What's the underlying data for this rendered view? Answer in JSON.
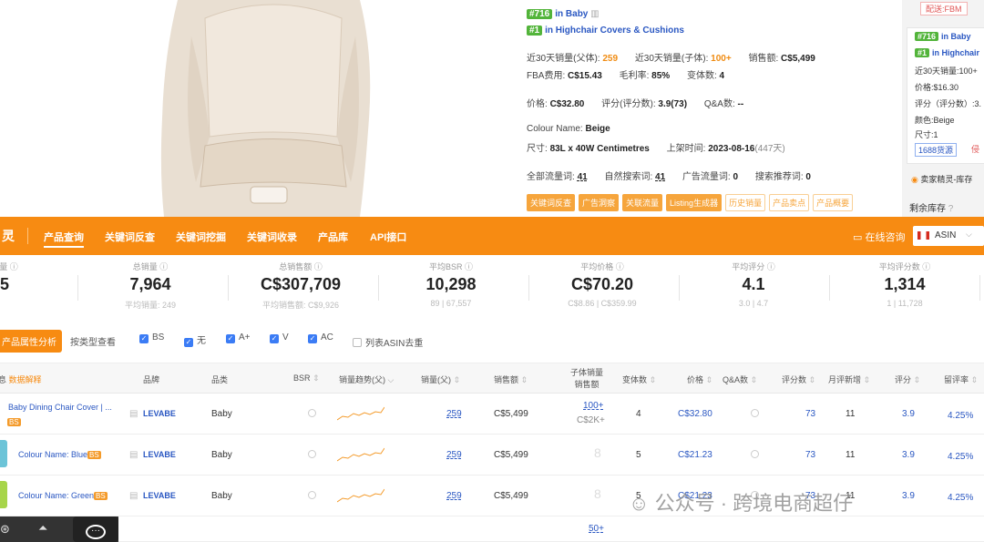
{
  "detail": {
    "rank1": {
      "badge": "#716",
      "text": "in Baby"
    },
    "rank2": {
      "badge": "#1",
      "text": "in Highchair Covers & Cushions"
    },
    "line1": {
      "a_label": "近30天销量(父体):",
      "a_val": "259",
      "b_label": "近30天销量(子体):",
      "b_val": "100+",
      "c_label": "销售额:",
      "c_val": "C$5,499"
    },
    "line2": {
      "a_label": "FBA费用:",
      "a_val": "C$15.43",
      "b_label": "毛利率:",
      "b_val": "85%",
      "c_label": "变体数:",
      "c_val": "4"
    },
    "line3": {
      "a_label": "价格:",
      "a_val": "C$32.80",
      "b_label": "评分(评分数):",
      "b_val": "3.9(73)",
      "c_label": "Q&A数:",
      "c_val": "--"
    },
    "colour": {
      "label": "Colour Name:",
      "val": "Beige"
    },
    "size": {
      "label": "尺寸:",
      "val": "83L x 40W Centimetres",
      "date_label": "上架时间:",
      "date_val": "2023-08-16",
      "days": "(447天)"
    },
    "keywords": {
      "a_label": "全部流量词:",
      "a_val": "41",
      "b_label": "自然搜索词:",
      "b_val": "41",
      "c_label": "广告流量词:",
      "c_val": "0",
      "d_label": "搜索推荐词:",
      "d_val": "0"
    },
    "tags": [
      "关键词反查",
      "广告洞察",
      "关联流量",
      "Listing生成器",
      "历史销量",
      "产品卖点",
      "产品概要"
    ]
  },
  "side": {
    "fbm": "配送:FBM",
    "rank1": {
      "badge": "#716",
      "text": "in Baby"
    },
    "rank2": {
      "badge": "#1",
      "text": "in Highchair"
    },
    "sales": "近30天销量:100+",
    "price": "价格:$16.30",
    "rating": "评分（评分数）:3.",
    "color": "颜色:Beige",
    "size": "尺寸:1",
    "src": "1688货源",
    "src2": "侵",
    "seller": "卖家精灵-库存",
    "stock": "剩余库存"
  },
  "toolbar": {
    "brand": "灵",
    "nav": [
      "产品查询",
      "关键词反查",
      "关键词挖掘",
      "关键词收录",
      "产品库",
      "API接口"
    ],
    "consult": "在线咨询",
    "asin": "ASIN"
  },
  "stats": [
    {
      "label": "数量",
      "value": "5",
      "sub": ""
    },
    {
      "label": "总销量",
      "value": "7,964",
      "sub": "平均销量: 249"
    },
    {
      "label": "总销售额",
      "value": "C$307,709",
      "sub": "平均销售额: C$9,926"
    },
    {
      "label": "平均BSR",
      "value": "10,298",
      "sub": "89 | 67,557"
    },
    {
      "label": "平均价格",
      "value": "C$70.20",
      "sub": "C$8.86 | C$359.99"
    },
    {
      "label": "平均评分",
      "value": "4.1",
      "sub": "3.0 | 4.7"
    },
    {
      "label": "平均评分数",
      "value": "1,314",
      "sub": "1 | 11,728"
    }
  ],
  "filters": {
    "analysis": "产品属性分析",
    "bytype": "按类型查看",
    "checks": [
      "BS",
      "无",
      "A+",
      "V",
      "AC"
    ],
    "dedupe": "列表ASIN去重"
  },
  "table": {
    "headers": {
      "info": "息",
      "tip": "数据解释",
      "brand": "品牌",
      "cat": "品类",
      "bsr": "BSR",
      "trend": "销量趋势(父)",
      "sales": "销量(父)",
      "rev": "销售额",
      "child1": "子体销量",
      "child2": "销售额",
      "var": "变体数",
      "price": "价格",
      "qa": "Q&A数",
      "ratings": "评分数",
      "monthly": "月评新增",
      "rating": "评分",
      "retention": "留评率"
    },
    "rows": [
      {
        "name": "Baby Dining Chair Cover | ...",
        "badge": "BS",
        "brand": "LEVABE",
        "cat": "Baby",
        "sales": "259",
        "rev": "C$5,499",
        "child1": "100+",
        "child2": "C$2K+",
        "var": "4",
        "price": "C$32.80",
        "ratings": "73",
        "monthly": "11",
        "rating": "3.9",
        "retention": "4.25%"
      },
      {
        "name": "Colour Name: Blue",
        "badge": "BS",
        "brand": "LEVABE",
        "cat": "Baby",
        "sales": "259",
        "rev": "C$5,499",
        "child1": "",
        "child2": "",
        "var": "5",
        "price": "C$21.23",
        "ratings": "73",
        "monthly": "11",
        "rating": "3.9",
        "retention": "4.25%"
      },
      {
        "name": "Colour Name: Green",
        "badge": "BS",
        "brand": "LEVABE",
        "cat": "Baby",
        "sales": "259",
        "rev": "C$5,499",
        "child1": "",
        "child2": "",
        "var": "5",
        "price": "C$21.23",
        "ratings": "73",
        "monthly": "11",
        "rating": "3.9",
        "retention": "4.25%"
      }
    ],
    "partial": "50+"
  },
  "watermark": "公众号 · 跨境电商超仔"
}
